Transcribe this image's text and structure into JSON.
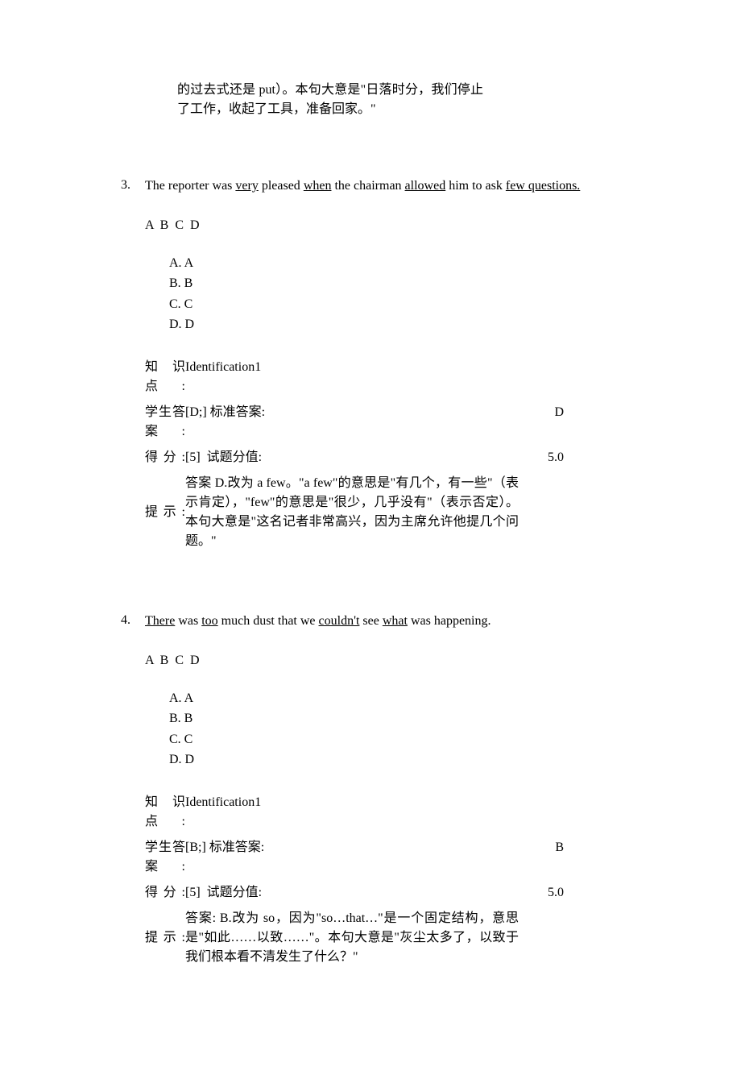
{
  "top_hint_continuation": "的过去式还是 put）。本句大意是\"日落时分，我们停止了工作，收起了工具，准备回家。\"",
  "labels": {
    "knowledge": "知识点:",
    "student_answer": "学生答案:",
    "standard_answer_label": "标准答案:",
    "score_label": "得分:",
    "item_value_label": "试题分值:",
    "hint": "提示:"
  },
  "choices": {
    "a": "A. A",
    "b": "B. B",
    "c": "C. C",
    "d": "D. D"
  },
  "abcd_row": "A B C D",
  "q3": {
    "number": "3.",
    "text_p1": "The reporter was ",
    "u1": "very",
    "text_p2": " pleased ",
    "u2": "when",
    "text_p3": " the chairman ",
    "u3": "allowed",
    "text_p4": " him to ask ",
    "u4": "few questions.",
    "knowledge": "Identification1",
    "student_answer": "[D;]",
    "standard_answer": "D",
    "score": "[5]",
    "item_value": "5.0",
    "hint": "答案 D.改为 a few。\"a few\"的意思是\"有几个，有一些\"（表示肯定），\"few\"的意思是\"很少，几乎没有\"（表示否定）。本句大意是\"这名记者非常高兴，因为主席允许他提几个问题。\""
  },
  "q4": {
    "number": "4.",
    "u1": "There",
    "text_p1": " was ",
    "u2": "too",
    "text_p2": " much dust that we ",
    "u3": "couldn't",
    "text_p3": " see ",
    "u4": "what",
    "text_p4": " was happening.",
    "knowledge": "Identification1",
    "student_answer": "[B;]",
    "standard_answer": "B",
    "score": "[5]",
    "item_value": "5.0",
    "hint": "答案: B.改为 so，因为\"so…that…\"是一个固定结构，意思是\"如此……以致……\"。本句大意是\"灰尘太多了，以致于我们根本看不清发生了什么？\""
  }
}
